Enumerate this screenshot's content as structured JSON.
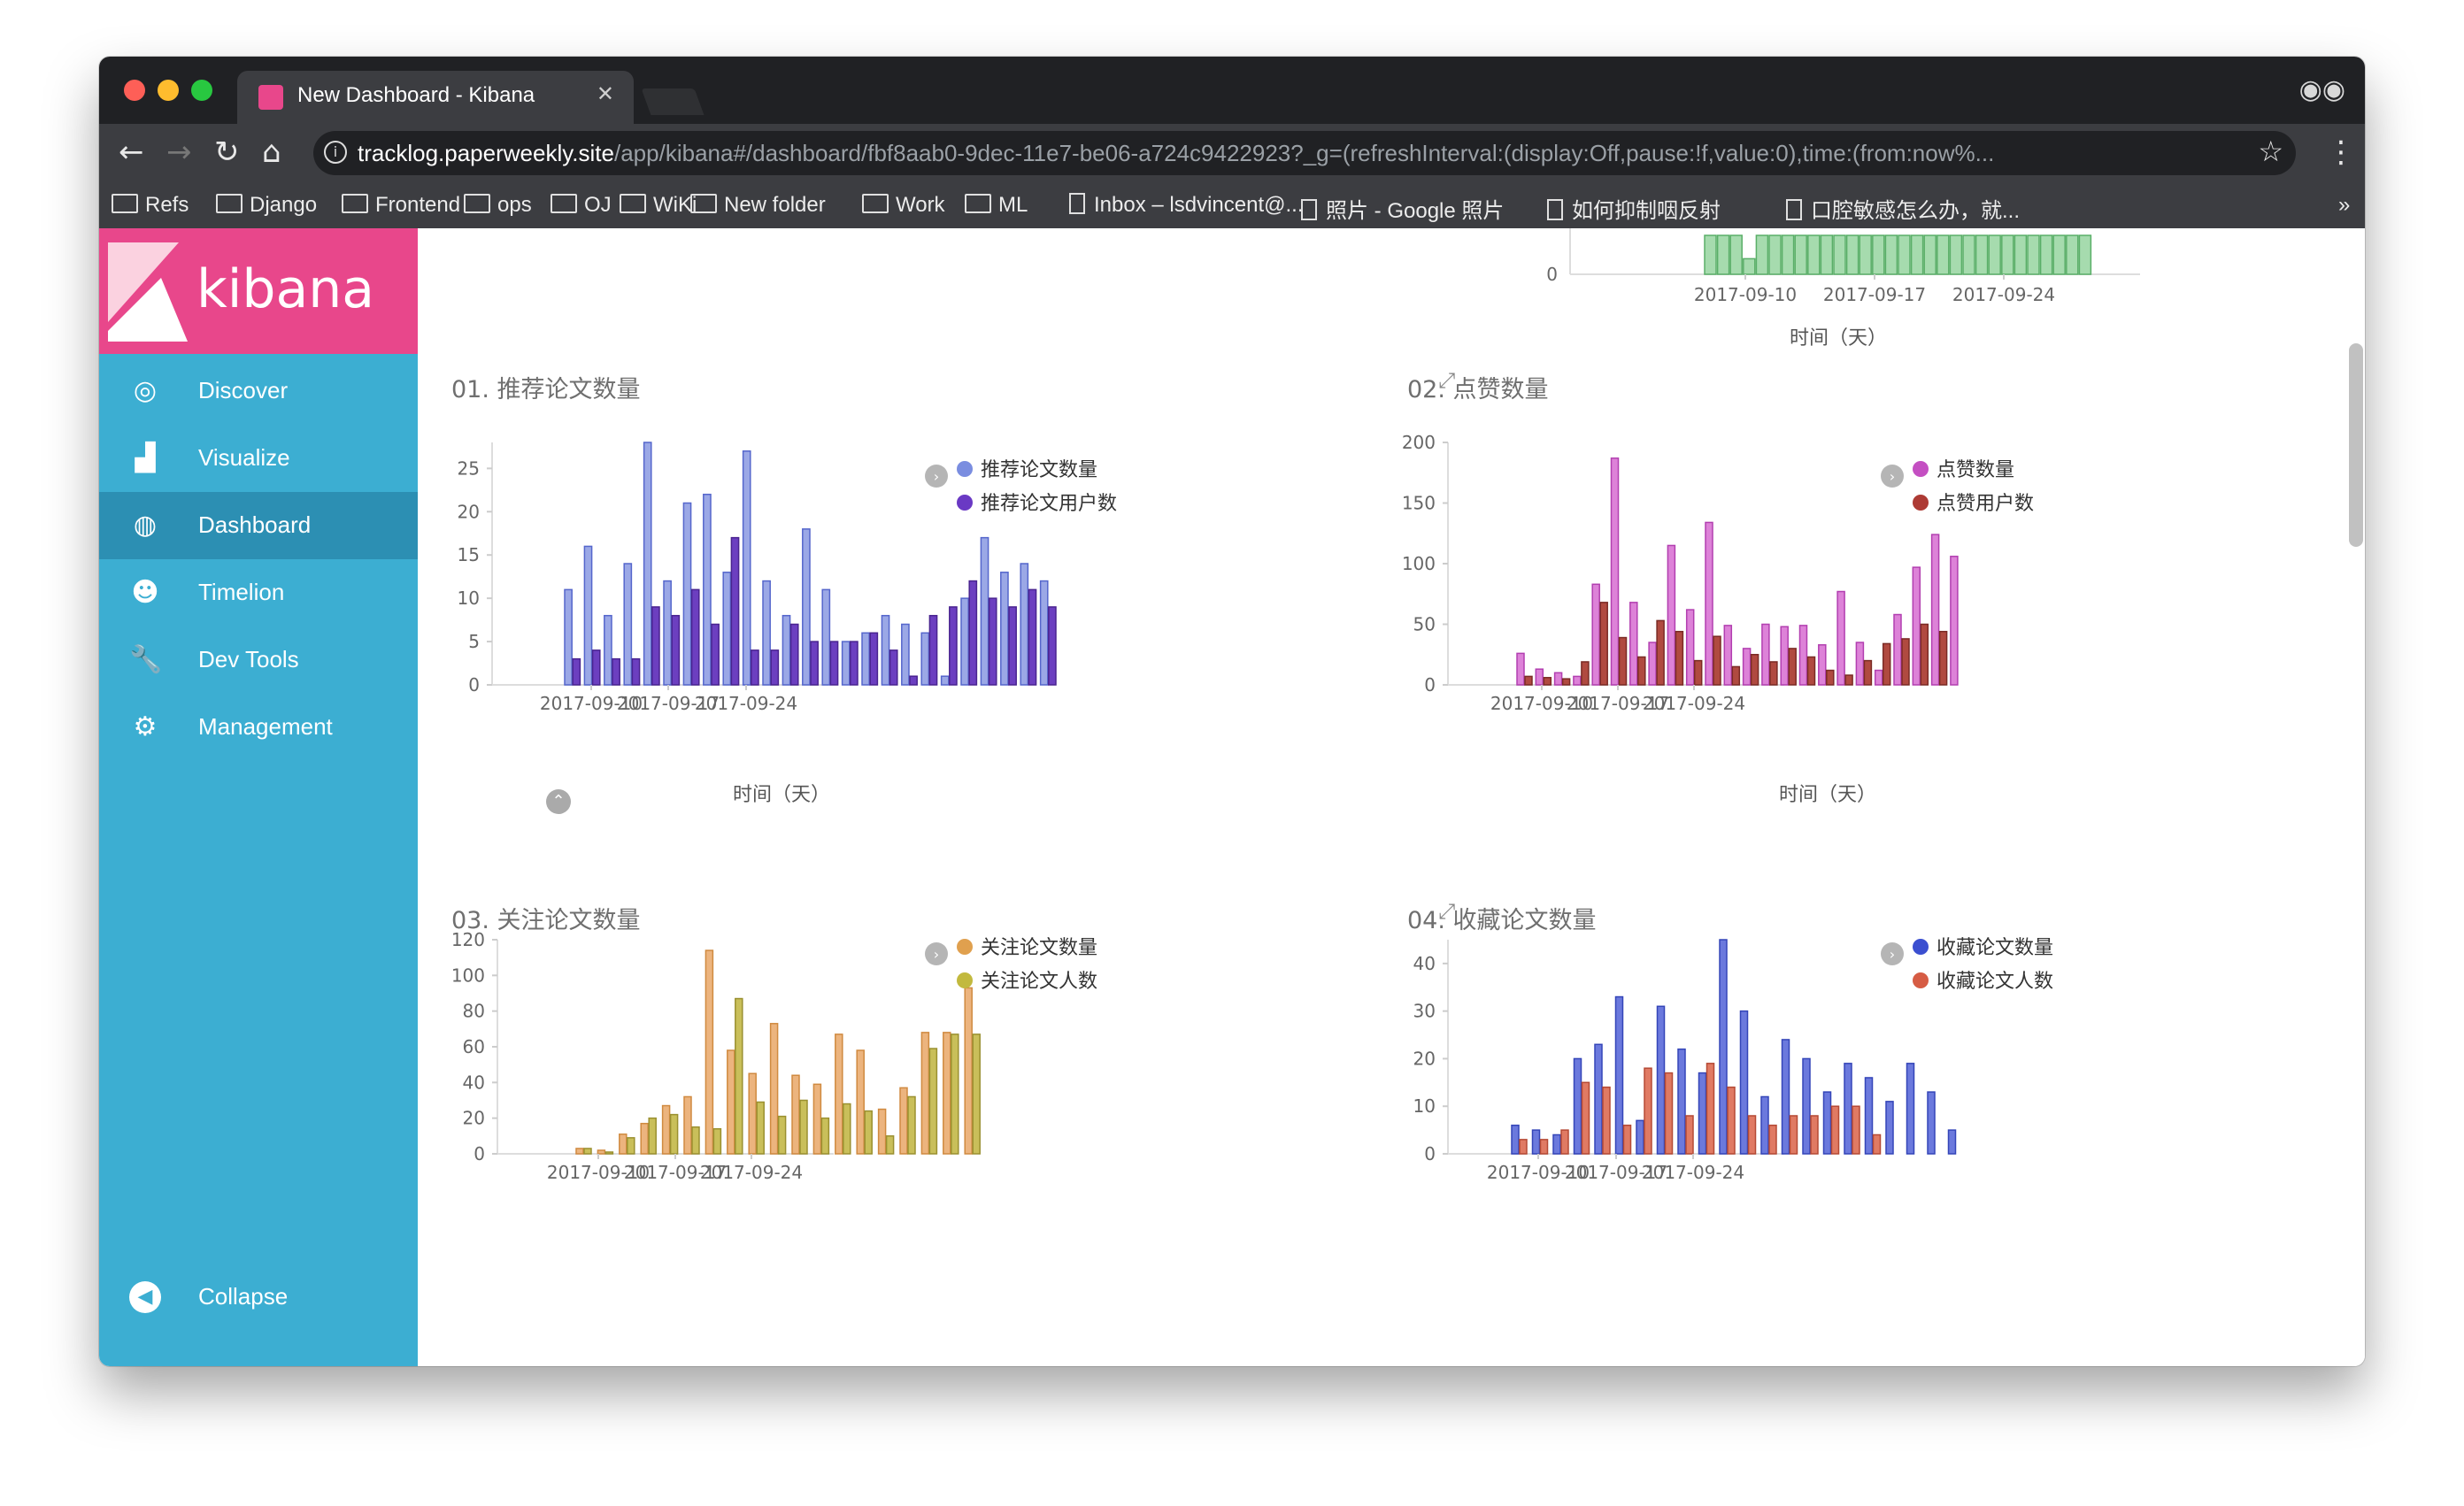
{
  "browser": {
    "tab_title": "New Dashboard - Kibana",
    "url_host": "tracklog.paperweekly.site",
    "url_path": "/app/kibana#/dashboard/fbf8aab0-9dec-11e7-be06-a724c9422923?_g=(refreshInterval:(display:Off,pause:!f,value:0),time:(from:now%...",
    "bookmarks": [
      {
        "label": "Refs",
        "type": "folder"
      },
      {
        "label": "Django",
        "type": "folder"
      },
      {
        "label": "Frontend",
        "type": "folder"
      },
      {
        "label": "ops",
        "type": "folder"
      },
      {
        "label": "OJ",
        "type": "folder"
      },
      {
        "label": "WiKi",
        "type": "folder"
      },
      {
        "label": "New folder",
        "type": "folder"
      },
      {
        "label": "Work",
        "type": "folder"
      },
      {
        "label": "ML",
        "type": "folder"
      },
      {
        "label": "Inbox – lsdvincent@...",
        "type": "page"
      },
      {
        "label": "照片 - Google 照片",
        "type": "page"
      },
      {
        "label": "如何抑制咽反射",
        "type": "page"
      },
      {
        "label": "口腔敏感怎么办，就...",
        "type": "page"
      }
    ],
    "more_bookmarks": "»"
  },
  "sidebar": {
    "logo": "kibana",
    "items": [
      {
        "label": "Discover",
        "icon": "compass-icon"
      },
      {
        "label": "Visualize",
        "icon": "bar-chart-icon"
      },
      {
        "label": "Dashboard",
        "icon": "dashboard-icon",
        "active": true
      },
      {
        "label": "Timelion",
        "icon": "timelion-icon"
      },
      {
        "label": "Dev Tools",
        "icon": "wrench-icon"
      },
      {
        "label": "Management",
        "icon": "gear-icon"
      }
    ],
    "collapse_label": "Collapse"
  },
  "colors": {
    "kibana_pink": "#e8478b",
    "sidebar_blue": "#3caed2"
  },
  "chart_data": [
    {
      "id": "top",
      "type": "bar",
      "title": "",
      "xlabel": "时间（天）",
      "x_ticks": [
        "2017-09-10",
        "2017-09-17",
        "2017-09-24"
      ],
      "y_ticks": [
        "0"
      ],
      "partial": true,
      "series": [
        {
          "values": [
            1,
            1,
            1,
            0.4,
            1,
            1,
            1,
            1,
            1,
            1,
            1,
            1,
            1,
            1,
            1,
            1,
            1,
            1,
            1,
            1,
            1,
            1,
            1,
            1,
            1,
            1,
            1,
            1,
            1,
            1
          ]
        }
      ]
    },
    {
      "id": "c1",
      "type": "bar",
      "title": "01. 推荐论文数量",
      "xlabel": "时间（天）",
      "ylim": [
        0,
        28
      ],
      "y_ticks": [
        "0",
        "5",
        "10",
        "15",
        "20",
        "25"
      ],
      "x_ticks": [
        "2017-09-10",
        "2017-09-17",
        "2017-09-24"
      ],
      "series": [
        {
          "name": "推荐论文数量",
          "values": [
            11,
            16,
            8,
            14,
            28,
            12,
            21,
            22,
            13,
            27,
            12,
            8,
            18,
            11,
            5,
            6,
            8,
            7,
            6,
            1,
            10,
            17,
            13,
            14,
            12
          ]
        },
        {
          "name": "推荐论文用户数",
          "values": [
            3,
            4,
            3,
            3,
            9,
            8,
            11,
            7,
            17,
            4,
            4,
            7,
            5,
            5,
            5,
            6,
            4,
            1,
            8,
            9,
            12,
            10,
            9,
            11,
            9
          ]
        }
      ]
    },
    {
      "id": "c2",
      "type": "bar",
      "title": "02. 点赞数量",
      "ylim": [
        0,
        200
      ],
      "y_ticks": [
        "0",
        "50",
        "100",
        "150",
        "200"
      ],
      "x_ticks": [
        "2017-09-10",
        "2017-09-17",
        "2017-09-24"
      ],
      "series": [
        {
          "name": "点赞数量",
          "values": [
            26,
            13,
            10,
            7,
            83,
            187,
            68,
            35,
            115,
            62,
            134,
            49,
            30,
            50,
            48,
            49,
            33,
            77,
            35,
            12,
            58,
            97,
            124,
            106
          ]
        },
        {
          "name": "点赞用户数",
          "values": [
            7,
            6,
            5,
            19,
            68,
            39,
            23,
            53,
            44,
            20,
            40,
            15,
            25,
            19,
            30,
            23,
            12,
            8,
            20,
            34,
            38,
            50,
            44
          ]
        }
      ]
    },
    {
      "id": "c3",
      "type": "bar",
      "title": "03. 关注论文数量",
      "ylim": [
        0,
        120
      ],
      "y_ticks": [
        "0",
        "20",
        "40",
        "60",
        "80",
        "100",
        "120"
      ],
      "x_ticks": [
        "2017-09-10",
        "2017-09-17",
        "2017-09-24"
      ],
      "series": [
        {
          "name": "关注论文数量",
          "values": [
            3,
            2,
            11,
            17,
            27,
            32,
            114,
            58,
            45,
            73,
            44,
            39,
            67,
            58,
            25,
            37,
            68,
            68,
            93
          ]
        },
        {
          "name": "关注论文人数",
          "values": [
            3,
            1,
            9,
            20,
            22,
            15,
            14,
            87,
            29,
            21,
            30,
            20,
            28,
            24,
            10,
            32,
            59,
            67,
            67
          ]
        }
      ]
    },
    {
      "id": "c4",
      "type": "bar",
      "title": "04. 收藏论文数量",
      "ylim": [
        0,
        45
      ],
      "y_ticks": [
        "0",
        "10",
        "20",
        "30",
        "40"
      ],
      "x_ticks": [
        "2017-09-10",
        "2017-09-17",
        "2017-09-24"
      ],
      "series": [
        {
          "name": "收藏论文数量",
          "values": [
            6,
            5,
            4,
            20,
            23,
            33,
            7,
            31,
            22,
            17,
            45,
            30,
            12,
            24,
            20,
            13,
            19,
            16,
            11,
            19,
            13,
            5
          ]
        },
        {
          "name": "收藏论文人数",
          "values": [
            3,
            3,
            5,
            15,
            14,
            6,
            18,
            17,
            8,
            19,
            14,
            8,
            6,
            8,
            8,
            10,
            10,
            4
          ]
        }
      ]
    }
  ]
}
